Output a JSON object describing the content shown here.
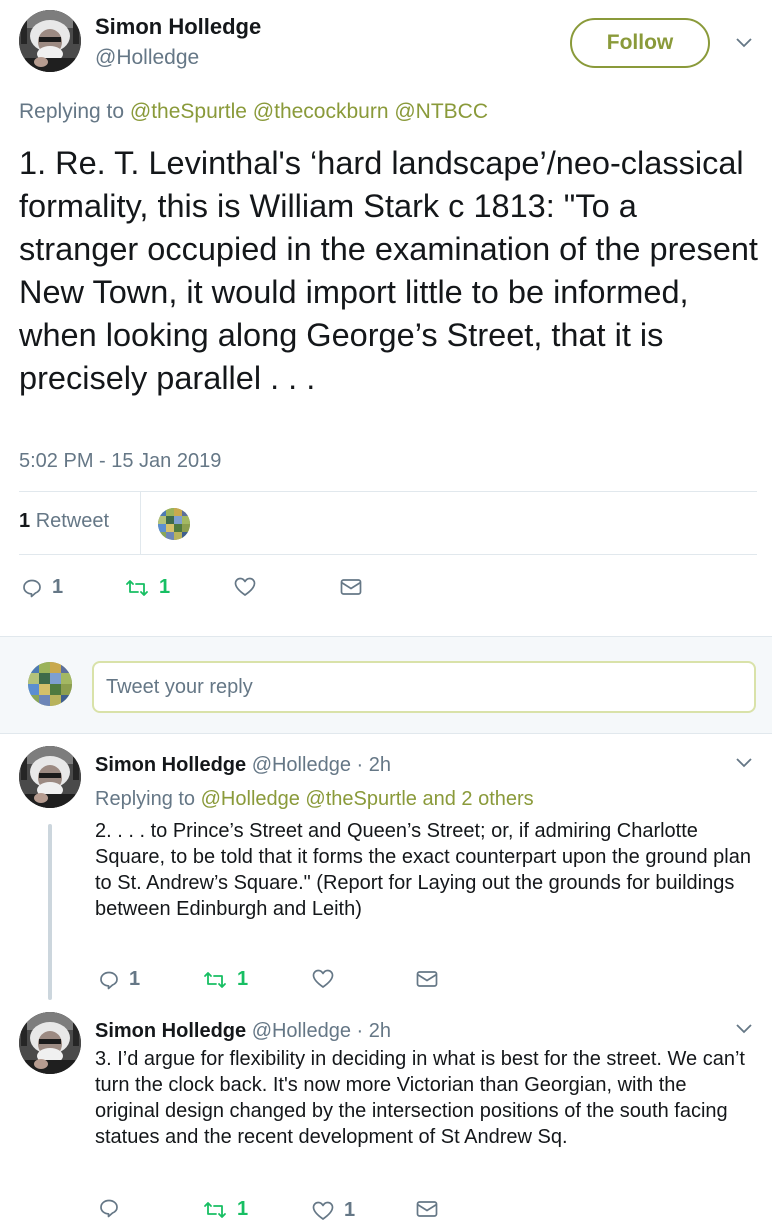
{
  "colors": {
    "accent": "#8a9a3a",
    "retweet": "#17bf63",
    "muted": "#657786",
    "text": "#14171a"
  },
  "main_tweet": {
    "name": "Simon Holledge",
    "handle": "@Holledge",
    "follow_label": "Follow",
    "replying_prefix": "Replying to ",
    "mentions": "@theSpurtle @thecockburn @NTBCC",
    "text": "1. Re. T. Levinthal's ‘hard landscape’/neo-classical formality, this is William Stark c 1813: \"To a stranger occupied in the examination of the present New Town, it would import little to be informed, when looking along George’s Street, that it is precisely parallel . . .",
    "timestamp": "5:02 PM - 15 Jan 2019",
    "retweet_count": "1",
    "retweet_label": "Retweet",
    "actions": {
      "replies": "1",
      "retweets": "1"
    }
  },
  "reply_box": {
    "placeholder": "Tweet your reply"
  },
  "replies": [
    {
      "name": "Simon Holledge",
      "handle_time": "@Holledge · 2h",
      "replying_prefix": "Replying to ",
      "mentions": "@Holledge @theSpurtle",
      "others": " and 2 others",
      "text": "2. . . . to Prince’s Street and Queen’s Street; or, if admiring Charlotte Square, to be told that it forms the exact counterpart upon the ground plan to St. Andrew’s Square.\" (Report for Laying out the grounds for buildings between Edinburgh and Leith)",
      "actions": {
        "replies": "1",
        "retweets": "1",
        "likes": ""
      }
    },
    {
      "name": "Simon Holledge",
      "handle_time": "@Holledge · 2h",
      "text": "3. I’d argue for flexibility in deciding in what is best for the street. We can’t turn the clock back. It's now more Victorian than Georgian, with the original design changed by the intersection positions of the south facing statues and the recent development of St Andrew Sq.",
      "actions": {
        "replies": "",
        "retweets": "1",
        "likes": "1"
      }
    }
  ],
  "icons": [
    "avatar",
    "chevron-down-icon",
    "reply-icon",
    "retweet-icon",
    "like-icon",
    "message-icon"
  ]
}
